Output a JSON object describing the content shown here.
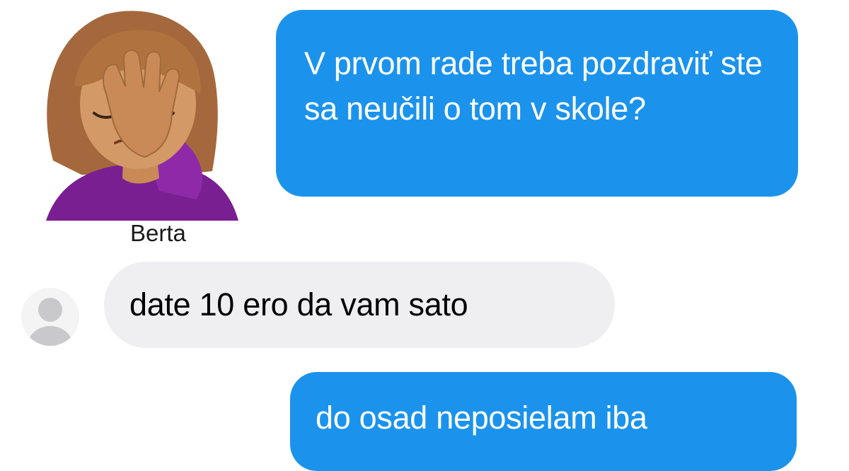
{
  "conversation": {
    "messages": [
      {
        "direction": "outgoing",
        "text": "V prvom rade treba pozdraviť ste sa neučili o tom v skole?"
      },
      {
        "direction": "incoming",
        "sender": "Berta",
        "text": "date 10 ero da vam sato"
      },
      {
        "direction": "outgoing",
        "text": "do osad neposielam iba"
      }
    ]
  },
  "decor": {
    "emoji": "woman-facepalming-icon"
  },
  "colors": {
    "outgoing_bubble": "#1b93ec",
    "incoming_bubble": "#efeff1",
    "avatar_placeholder": "#c9c9cc"
  }
}
